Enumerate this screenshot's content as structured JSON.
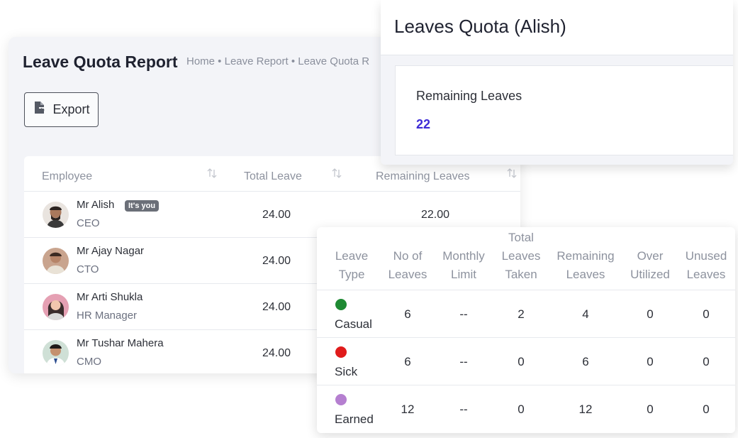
{
  "report": {
    "title": "Leave Quota Report",
    "breadcrumb": "Home • Leave Report • Leave Quota R",
    "export_label": "Export",
    "columns": {
      "employee": "Employee",
      "total_leave": "Total Leave",
      "remaining": "Remaining Leaves"
    },
    "badge_you": "It's you",
    "employees": [
      {
        "name": "Mr Alish",
        "role": "CEO",
        "total": "24.00",
        "remaining": "22.00"
      },
      {
        "name": "Mr Ajay Nagar",
        "role": "CTO",
        "total": "24.00",
        "remaining": ""
      },
      {
        "name": "Mr Arti Shukla",
        "role": "HR Manager",
        "total": "24.00",
        "remaining": ""
      },
      {
        "name": "Mr Tushar Mahera",
        "role": "CMO",
        "total": "24.00",
        "remaining": ""
      }
    ]
  },
  "quota": {
    "title": "Leaves Quota (Alish)",
    "remaining_label": "Remaining Leaves",
    "remaining_value": "22"
  },
  "leave_types": {
    "headers": {
      "leave_type": [
        "Leave",
        "Type"
      ],
      "no_of": [
        "No of",
        "Leaves"
      ],
      "monthly": [
        "Monthly",
        "Limit"
      ],
      "taken": [
        "Total",
        "Leaves",
        "Taken"
      ],
      "remaining": [
        "Remaining",
        "Leaves"
      ],
      "over": [
        "Over",
        "Utilized"
      ],
      "unused": [
        "Unused",
        "Leaves"
      ]
    },
    "rows": [
      {
        "name": "Casual",
        "color": "#1e8a33",
        "no_of": "6",
        "monthly": "--",
        "taken": "2",
        "remaining": "4",
        "over": "0",
        "unused": "0"
      },
      {
        "name": "Sick",
        "color": "#e01b1b",
        "no_of": "6",
        "monthly": "--",
        "taken": "0",
        "remaining": "6",
        "over": "0",
        "unused": "0"
      },
      {
        "name": "Earned",
        "color": "#b57fd0",
        "no_of": "12",
        "monthly": "--",
        "taken": "0",
        "remaining": "12",
        "over": "0",
        "unused": "0"
      }
    ]
  }
}
